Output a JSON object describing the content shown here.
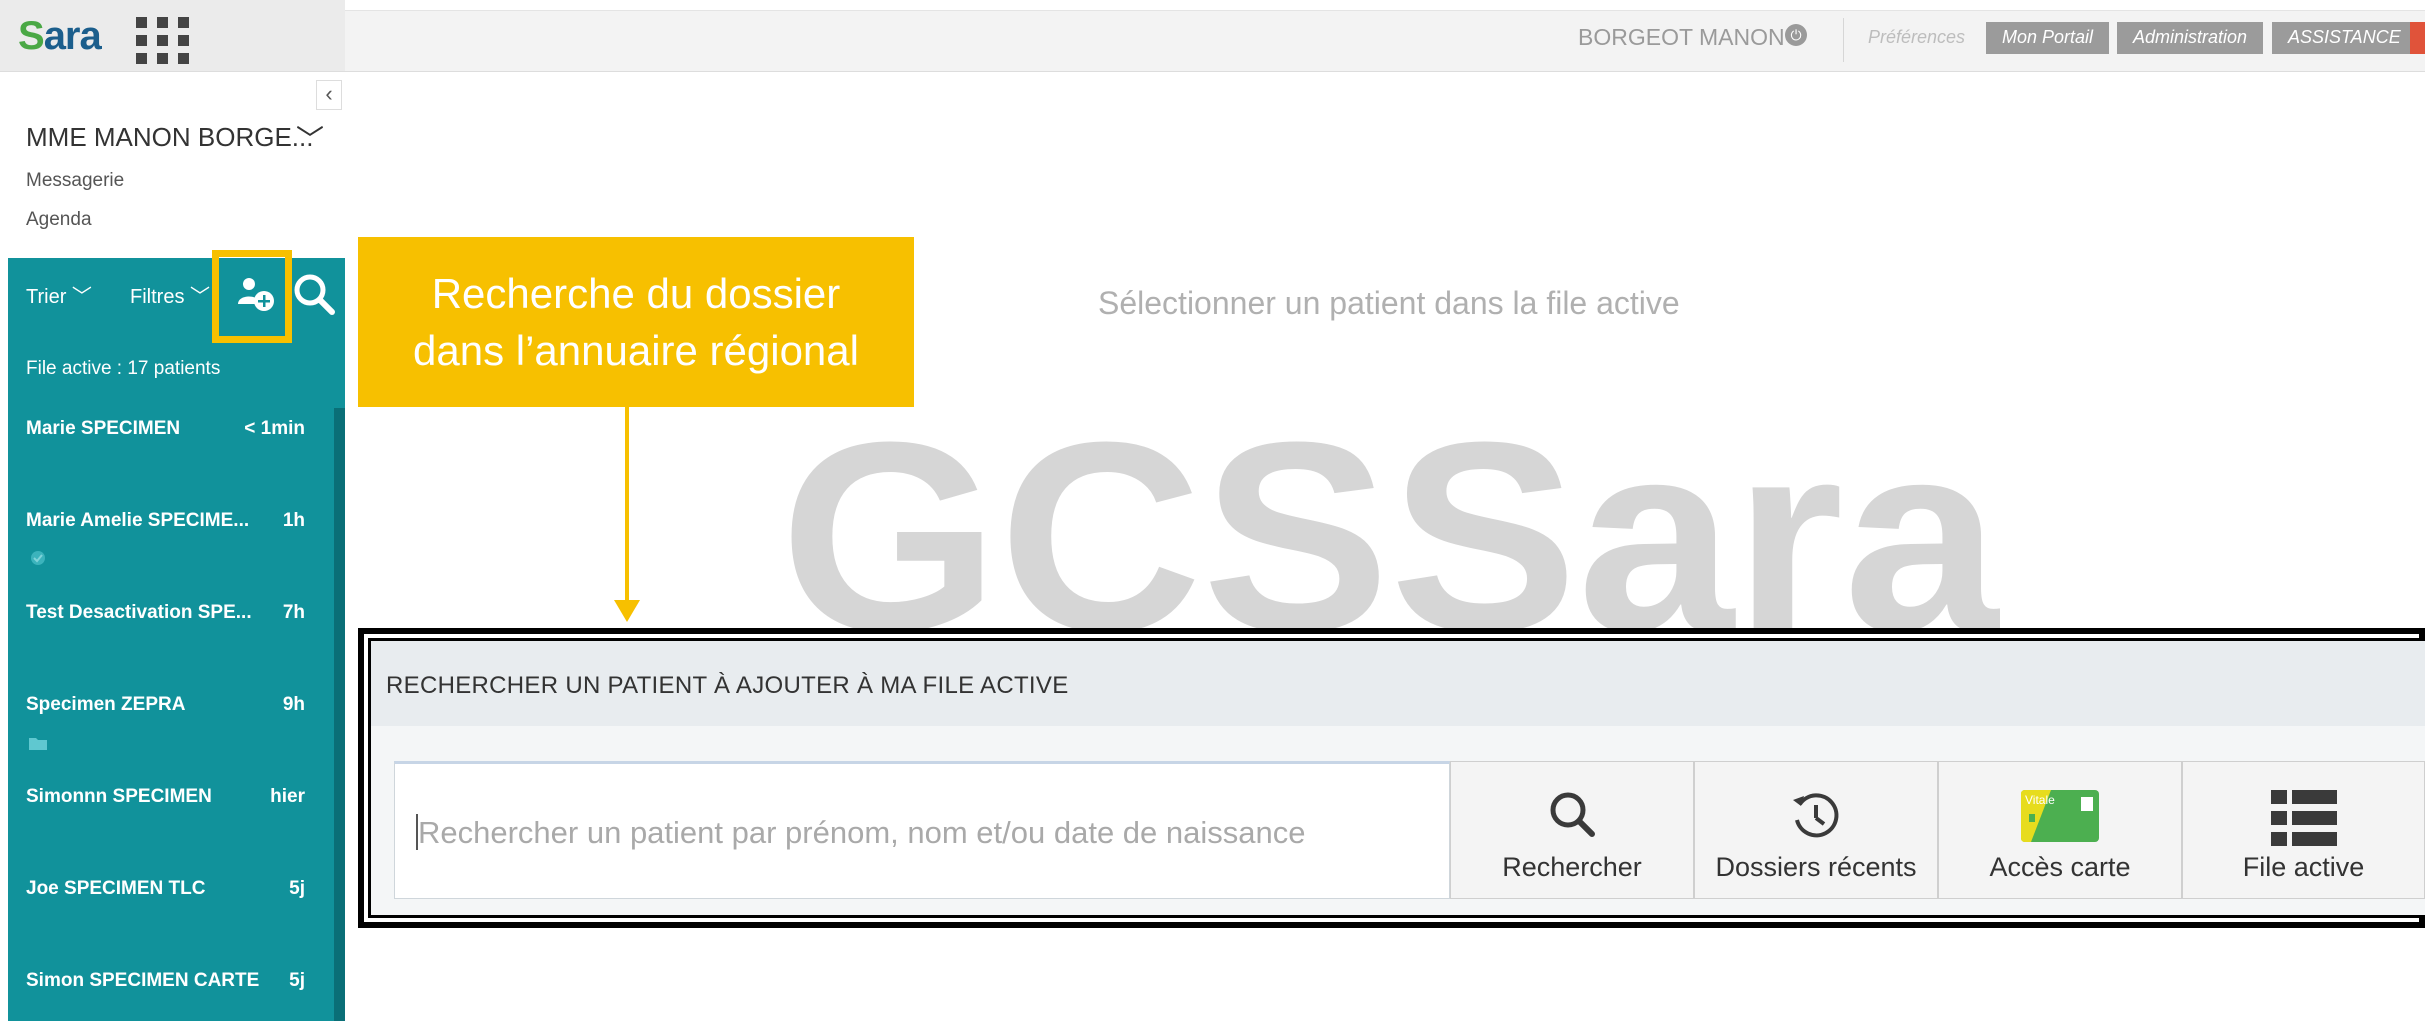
{
  "app": {
    "logo": {
      "prefix": "S",
      "rest": "ara"
    },
    "user_name": "BORGEOT MANON",
    "links": {
      "preferences": "Préférences",
      "portail": "Mon Portail",
      "administration": "Administration",
      "assistance": "ASSISTANCE"
    },
    "accent_colors": {
      "teal": "#11929b",
      "callout": "#f7c000",
      "header_btn": "#9b9b9b"
    }
  },
  "sidebar": {
    "collapse_glyph": "‹",
    "profile_name": "MME MANON BORGE...",
    "profile_chevron": "﹀",
    "messagerie": "Messagerie",
    "agenda": "Agenda",
    "trier": "Trier ﹀",
    "filtres": "Filtres ﹀",
    "file_count": "File active : 17 patients",
    "patients": [
      {
        "name": "Marie SPECIMEN",
        "time": "< 1min"
      },
      {
        "name": "Marie Amelie SPECIME...",
        "time": "1h",
        "badge": "check-icon"
      },
      {
        "name": "Test Desactivation SPE...",
        "time": "7h"
      },
      {
        "name": "Specimen ZEPRA",
        "time": "9h",
        "badge": "folder-icon"
      },
      {
        "name": "Simonnn SPECIMEN",
        "time": "hier"
      },
      {
        "name": "Joe SPECIMEN TLC",
        "time": "5j"
      },
      {
        "name": "Simon SPECIMEN CARTE",
        "time": "5j"
      }
    ]
  },
  "main": {
    "select_message": "Sélectionner un patient dans la file active",
    "watermark_text": "GCSSara"
  },
  "callout": {
    "line1": "Recherche du dossier",
    "line2": "dans l’annuaire régional"
  },
  "search_panel": {
    "title": "RECHERCHER UN PATIENT À AJOUTER À MA FILE ACTIVE",
    "placeholder": "Rechercher un patient par prénom, nom et/ou date de naissance",
    "buttons": {
      "rechercher": "Rechercher",
      "recents": "Dossiers récents",
      "carte": "Accès carte",
      "file": "File active",
      "carte_badge": "Vitale"
    }
  }
}
